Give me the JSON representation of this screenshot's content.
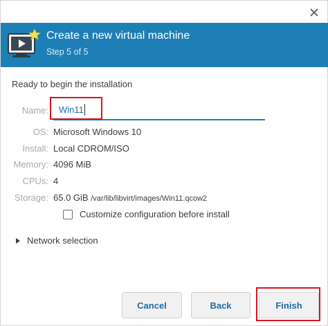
{
  "header": {
    "title": "Create a new virtual machine",
    "step": "Step 5 of 5"
  },
  "intro": "Ready to begin the installation",
  "fields": {
    "name": {
      "label": "Name:",
      "value": "Win11"
    },
    "os": {
      "label": "OS:",
      "value": "Microsoft Windows 10"
    },
    "install": {
      "label": "Install:",
      "value": "Local CDROM/ISO"
    },
    "memory": {
      "label": "Memory:",
      "value": "4096 MiB"
    },
    "cpus": {
      "label": "CPUs:",
      "value": "4"
    },
    "storage": {
      "label": "Storage:",
      "size": "65.0 GiB",
      "path": "/var/lib/libvirt/images/Win11.qcow2"
    }
  },
  "customize_checkbox": {
    "label": "Customize configuration before install",
    "checked": false
  },
  "network_expander": {
    "label": "Network selection"
  },
  "buttons": {
    "cancel": "Cancel",
    "back": "Back",
    "finish": "Finish"
  },
  "colors": {
    "banner": "#1d7fb5",
    "accent_text": "#1d6fa5",
    "highlight": "#e0101a"
  },
  "icons": {
    "close": "close-icon",
    "banner": "monitor-play-icon",
    "expander": "triangle-right-icon"
  }
}
